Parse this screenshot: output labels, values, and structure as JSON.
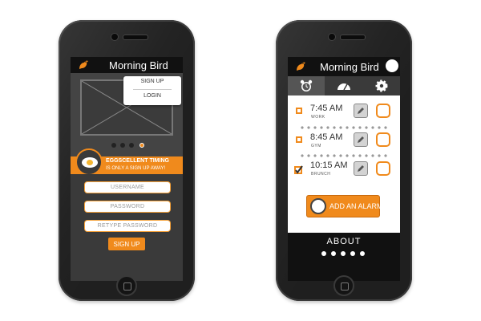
{
  "left_phone": {
    "app_title": "Morning Bird",
    "menu": [
      "SIGN UP",
      "LOGIN"
    ],
    "carousel_dots": 4,
    "banner": {
      "line1": "EGGSCELLENT TIMING",
      "line2": "IS ONLY A SIGN UP AWAY!"
    },
    "fields": [
      {
        "placeholder": "USERNAME"
      },
      {
        "placeholder": "PASSWORD"
      },
      {
        "placeholder": "RETYPE PASSWORD"
      }
    ],
    "signup_button": "SIGN UP"
  },
  "right_phone": {
    "app_title": "Morning Bird",
    "tabs": [
      {
        "icon": "alarm-clock-icon"
      },
      {
        "icon": "gauge-icon"
      },
      {
        "icon": "gear-icon"
      }
    ],
    "alarms": [
      {
        "time": "7:45 AM",
        "label": "WORK"
      },
      {
        "time": "8:45 AM",
        "label": "GYM"
      },
      {
        "time": "10:15 AM",
        "label": "BRUNCH"
      }
    ],
    "add_button": "ADD AN ALARM",
    "about_label": "ABOUT",
    "page_dots": 5
  },
  "colors": {
    "accent": "#f08a1c",
    "phone_body": "#1f1f1f",
    "screen_dark": "#444444"
  }
}
